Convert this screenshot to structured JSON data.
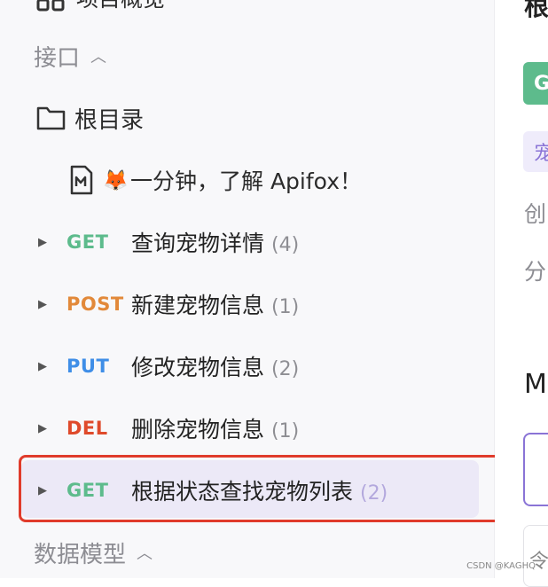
{
  "sidebar": {
    "partial_top_label": "项目概览",
    "interfaces_section": {
      "label": "接口",
      "caret": "^"
    },
    "root_folder": {
      "label": "根目录",
      "icon": "folder-icon"
    },
    "doc_item": {
      "emoji": "🦊",
      "label": "一分钟，了解 Apifox！",
      "icon": "markdown-doc-icon"
    },
    "apis": [
      {
        "method": "GET",
        "method_color": "#5dbb8c",
        "name": "查询宠物详情",
        "count": "(4)"
      },
      {
        "method": "POST",
        "method_color": "#e2893a",
        "name": "新建宠物信息",
        "count": "(1)"
      },
      {
        "method": "PUT",
        "method_color": "#3f8ee7",
        "name": "修改宠物信息",
        "count": "(2)"
      },
      {
        "method": "DEL",
        "method_color": "#df4a2b",
        "name": "删除宠物信息",
        "count": "(1)"
      },
      {
        "method": "GET",
        "method_color": "#5dbb8c",
        "name": "根据状态查找宠物列表",
        "count": "(2)",
        "selected": true
      }
    ],
    "models_section": {
      "label": "数据模型",
      "caret": "^"
    }
  },
  "main": {
    "heading_partial": "根",
    "method_badge_partial": "G",
    "tag_partial": "宠",
    "created_partial": "创",
    "category_partial": "分",
    "section_partial": "M",
    "bottom_partial": "令"
  },
  "watermark": "CSDN @KAGHQ",
  "colors": {
    "highlight": "#e03b2b",
    "selected_bg": "#ece9f7",
    "accent": "#8a74d6"
  }
}
